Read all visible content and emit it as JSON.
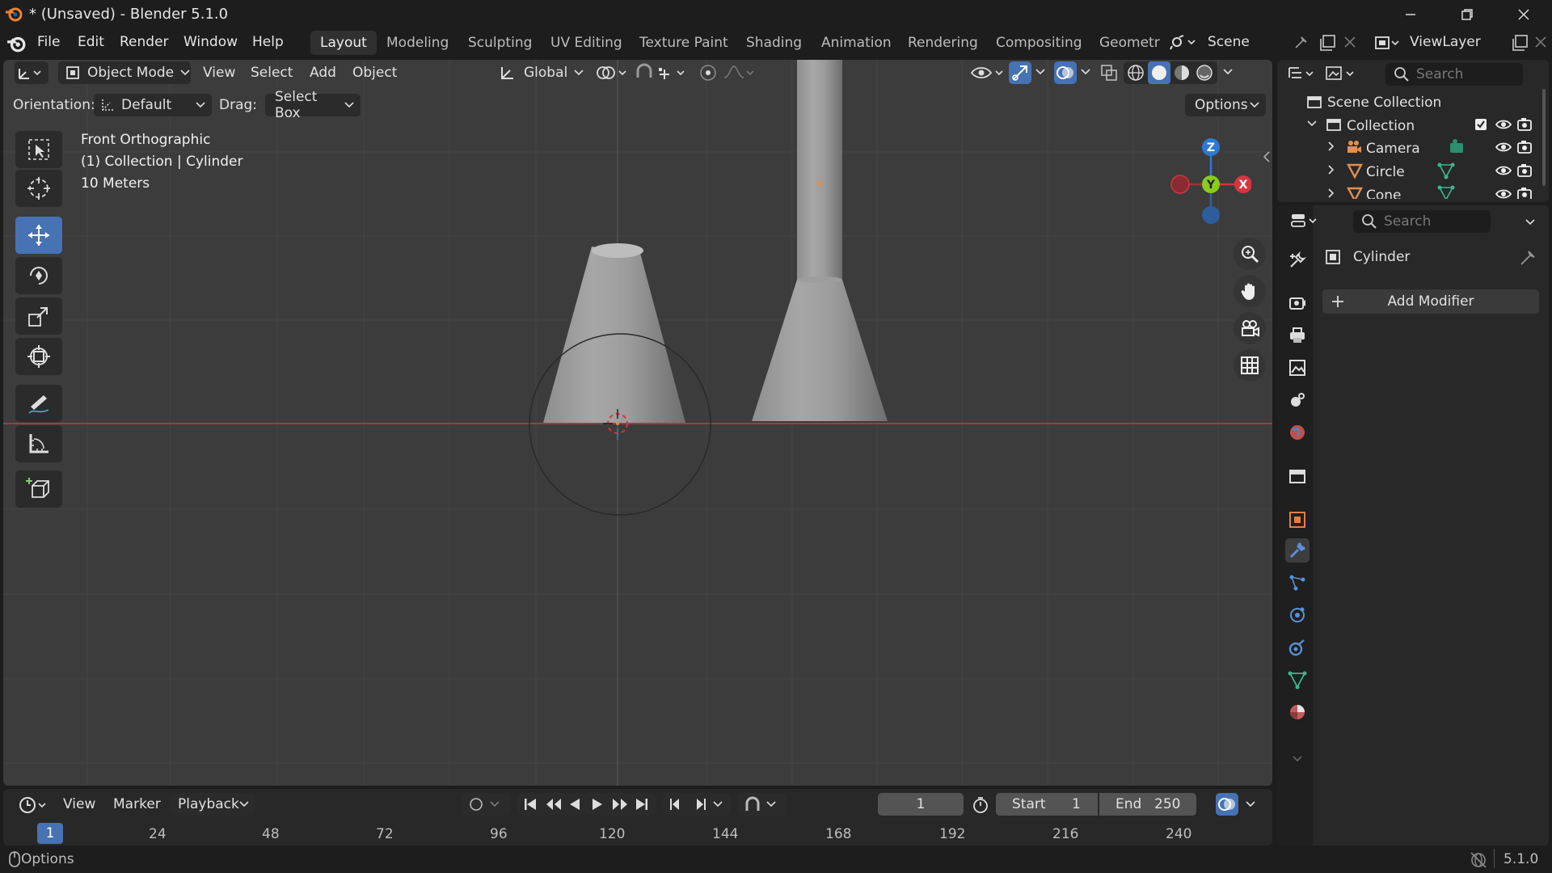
{
  "window": {
    "title": "* (Unsaved) - Blender 5.1.0"
  },
  "menu": {
    "items": [
      "File",
      "Edit",
      "Render",
      "Window",
      "Help"
    ]
  },
  "workspaces": [
    "Layout",
    "Modeling",
    "Sculpting",
    "UV Editing",
    "Texture Paint",
    "Shading",
    "Animation",
    "Rendering",
    "Compositing",
    "Geometr"
  ],
  "active_workspace": "Layout",
  "scene": {
    "label": "Scene"
  },
  "view_layer": {
    "label": "ViewLayer"
  },
  "viewport_header": {
    "mode": "Object Mode",
    "menus": [
      "View",
      "Select",
      "Add",
      "Object"
    ],
    "transform_orientation": "Global"
  },
  "tool_settings": {
    "orientation_label": "Orientation:",
    "orientation_value": "Default",
    "drag_label": "Drag:",
    "drag_value": "Select Box",
    "options_label": "Options"
  },
  "overlay_text": {
    "view_name": "Front Orthographic",
    "object_info": "(1) Collection | Cylinder",
    "scale": "10 Meters"
  },
  "gizmo_axes": {
    "z": "Z",
    "y": "Y",
    "x": "X"
  },
  "outliner": {
    "search_placeholder": "Search",
    "root": "Scene Collection",
    "collection": "Collection",
    "items": [
      {
        "name": "Camera",
        "icon": "camera-icon"
      },
      {
        "name": "Circle",
        "icon": "mesh-icon"
      },
      {
        "name": "Cone",
        "icon": "mesh-icon"
      }
    ]
  },
  "properties": {
    "search_placeholder": "Search",
    "object_name": "Cylinder",
    "add_modifier_label": "Add Modifier",
    "active_tab": "modifier-tab"
  },
  "timeline": {
    "menus": [
      "View",
      "Marker",
      "Playback"
    ],
    "current_frame": "1",
    "start_label": "Start",
    "start_value": "1",
    "end_label": "End",
    "end_value": "250",
    "ruler_ticks": [
      "1",
      "24",
      "48",
      "72",
      "96",
      "120",
      "144",
      "168",
      "192",
      "216",
      "240"
    ]
  },
  "status": {
    "left": "Options",
    "version": "5.1.0"
  },
  "colors": {
    "accent": "#4772b3",
    "x_axis": "#d6353f",
    "y_axis": "#8bcb1f",
    "z_axis": "#2c7ad4",
    "viewport_bg": "#3c3c3c",
    "object_origin": "#f28a2f"
  }
}
